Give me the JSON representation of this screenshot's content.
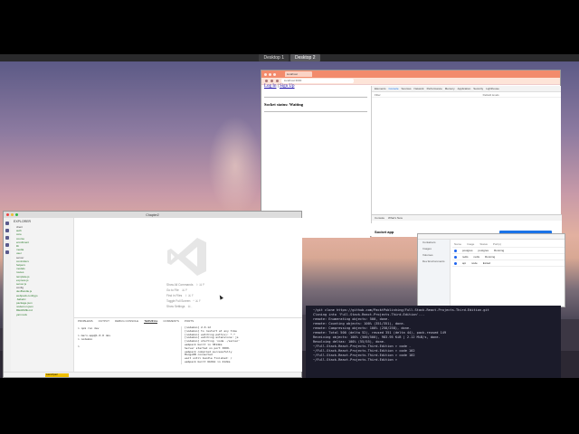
{
  "desktops": [
    "Desktop 1",
    "Desktop 2"
  ],
  "browser": {
    "tab_title": "localhost",
    "url": "localhost:3000",
    "links": {
      "login": "Log In",
      "signup": "Sign Up"
    },
    "socket_label": "Socket status:",
    "socket_value": "Waiting",
    "devtools_tabs": [
      "Elements",
      "Console",
      "Sources",
      "Network",
      "Performance",
      "Memory",
      "Application",
      "Security",
      "Lighthouse"
    ],
    "devtools_filter": "Filter",
    "devtools_levels": "Default levels",
    "drawer_tabs": [
      "Console",
      "What's New"
    ],
    "drawer_msg": "Highlights from the Chrome 94 update"
  },
  "socket_app": {
    "title": "Socket app"
  },
  "docker": {
    "sidebar": [
      "Containers",
      "Images",
      "Volumes",
      "Dev Environments"
    ],
    "headers": [
      "Name",
      "Image",
      "Status",
      "Port(s)"
    ],
    "rows": [
      {
        "name": "postgres",
        "image": "postgres",
        "status": "Running"
      },
      {
        "name": "redis",
        "image": "redis",
        "status": "Running"
      },
      {
        "name": "api",
        "image": "node",
        "status": "Exited"
      }
    ]
  },
  "terminal": {
    "lines": [
      "~/git clone https://github.com/PacktPublishing/Full-Stack-React-Projects-Third-Edition.git",
      "Cloning into 'Full-Stack-React-Projects-Third-Edition'...",
      "remote: Enumerating objects: 500, done.",
      "remote: Counting objects: 100% (351/351), done.",
      "remote: Compressing objects: 100% (258/258), done.",
      "remote: Total 500 (delta 52), reused 351 (delta 44), pack-reused 149",
      "Receiving objects: 100% (500/500), 983.95 KiB | 2.12 MiB/s, done.",
      "Resolving deltas: 100% (55/55), done.",
      "~/Full-Stack-React-Projects-Third-Edition > code .",
      "~/Full-Stack-React-Projects-Third-Edition > code 102",
      "~/Full-Stack-React-Projects-Third-Edition > code 102",
      "~/Full-Stack-React-Projects-Third-Edition > "
    ]
  },
  "vscode": {
    "title": "Chapter2",
    "explorer_title": "EXPLORER",
    "files": [
      "client",
      "auth",
      "core",
      "course",
      "enrollment",
      "lib",
      "media",
      "user",
      "server",
      "controllers",
      "helpers",
      "models",
      "routes",
      "template.js",
      "express.js",
      "server.js",
      "config",
      "devBundle.js",
      "webpack.config.js",
      ".babelrc",
      "package.json",
      "nodemon.json",
      "README.md",
      "yarn.lock"
    ],
    "hints": [
      {
        "label": "Show All Commands",
        "keys": "⇧ ⌘ P"
      },
      {
        "label": "Go to File",
        "keys": "⌘ P"
      },
      {
        "label": "Find in Files",
        "keys": "⇧ ⌘ F"
      },
      {
        "label": "Toggle Full Screen",
        "keys": "^ ⌘ F"
      },
      {
        "label": "Show Settings",
        "keys": "⌘ ,"
      }
    ],
    "panel_tabs": [
      "PROBLEMS",
      "OUTPUT",
      "DEBUG CONSOLE",
      "TERMINAL",
      "COMMENTS",
      "PORTS"
    ],
    "term_left": "> npm run dev\n\n> mern-app@1.0.0 dev\n> nodemon\n\n>",
    "term_right": "[nodemon] 2.0.12\n[nodemon] to restart at any time\n[nodemon] watching path(s): *.*\n[nodemon] watching extensions: js\n[nodemon] starting `node ./server`\nwebpack built in 3814ms\nServer started on port 3000.\nwebpack compiled successfully\nMongoDB connected\nwait until bundle finished: /\nwebpack built 6b9b1 in 412ms",
    "status_warn": "Launchpad"
  }
}
